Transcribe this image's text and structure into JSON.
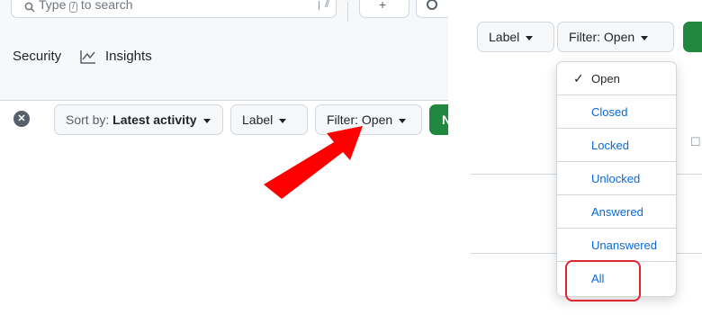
{
  "left": {
    "search": {
      "text_before": "Type",
      "key": "/",
      "text_after": "to search",
      "search_icon": "search-icon",
      "command_icon": "command-palette-icon"
    },
    "header_actions": {
      "plus_icon": "plus-icon",
      "issue_icon": "issue-opened-icon"
    },
    "tabs": {
      "security": "Security",
      "insights": "Insights",
      "insights_icon": "graph-icon"
    },
    "toolbar": {
      "clear_icon": "x-circle-fill-icon",
      "sort_prefix": "Sort by:",
      "sort_value": "Latest activity",
      "label": "Label",
      "filter": "Filter: Open",
      "new_initial": "N"
    },
    "annotation": {
      "arrow_color": "#ff0000"
    }
  },
  "right": {
    "toolbar": {
      "label": "Label",
      "filter": "Filter: Open"
    },
    "dropdown": {
      "items": [
        {
          "label": "Open",
          "selected": true
        },
        {
          "label": "Closed",
          "selected": false
        },
        {
          "label": "Locked",
          "selected": false
        },
        {
          "label": "Unlocked",
          "selected": false
        },
        {
          "label": "Answered",
          "selected": false
        },
        {
          "label": "Unanswered",
          "selected": false
        },
        {
          "label": "All",
          "selected": false
        }
      ],
      "highlight_color": "#e3232c",
      "link_color": "#0969da"
    }
  },
  "colors": {
    "primary_green": "#1f883d",
    "border": "#d0d7de",
    "header_bg": "#f6f8fa"
  }
}
